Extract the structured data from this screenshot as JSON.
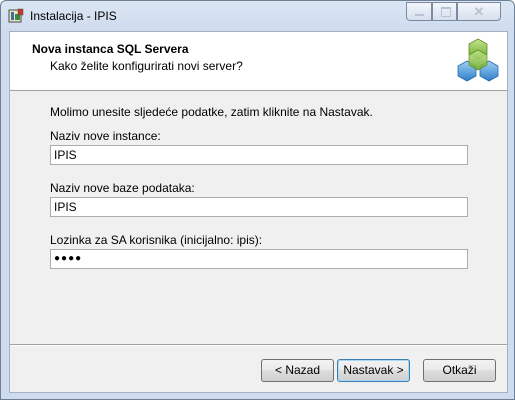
{
  "window": {
    "title": "Instalacija - IPIS"
  },
  "header": {
    "title": "Nova instanca SQL Servera",
    "subtitle": "Kako želite konfigurirati novi server?"
  },
  "body": {
    "intro": "Molimo unesite sljedeće podatke, zatim kliknite na Nastavak.",
    "fields": [
      {
        "label": "Naziv nove instance:",
        "value": "IPIS"
      },
      {
        "label": "Naziv nove baze podataka:",
        "value": "IPIS"
      },
      {
        "label": "Lozinka za SA korisnika (inicijalno: ipis):",
        "value": "●●●●"
      }
    ]
  },
  "buttons": {
    "back": "< Nazad",
    "next": "Nastavak >",
    "cancel": "Otkaži"
  },
  "window_controls": {
    "close_glyph": "✕"
  },
  "icons": [
    "app-setup-icon",
    "minimize-icon",
    "maximize-icon",
    "close-icon",
    "hexagon-logo-icon"
  ],
  "colors": {
    "hex_green": "#8dc63f",
    "hex_blue": "#3f8fd2"
  }
}
